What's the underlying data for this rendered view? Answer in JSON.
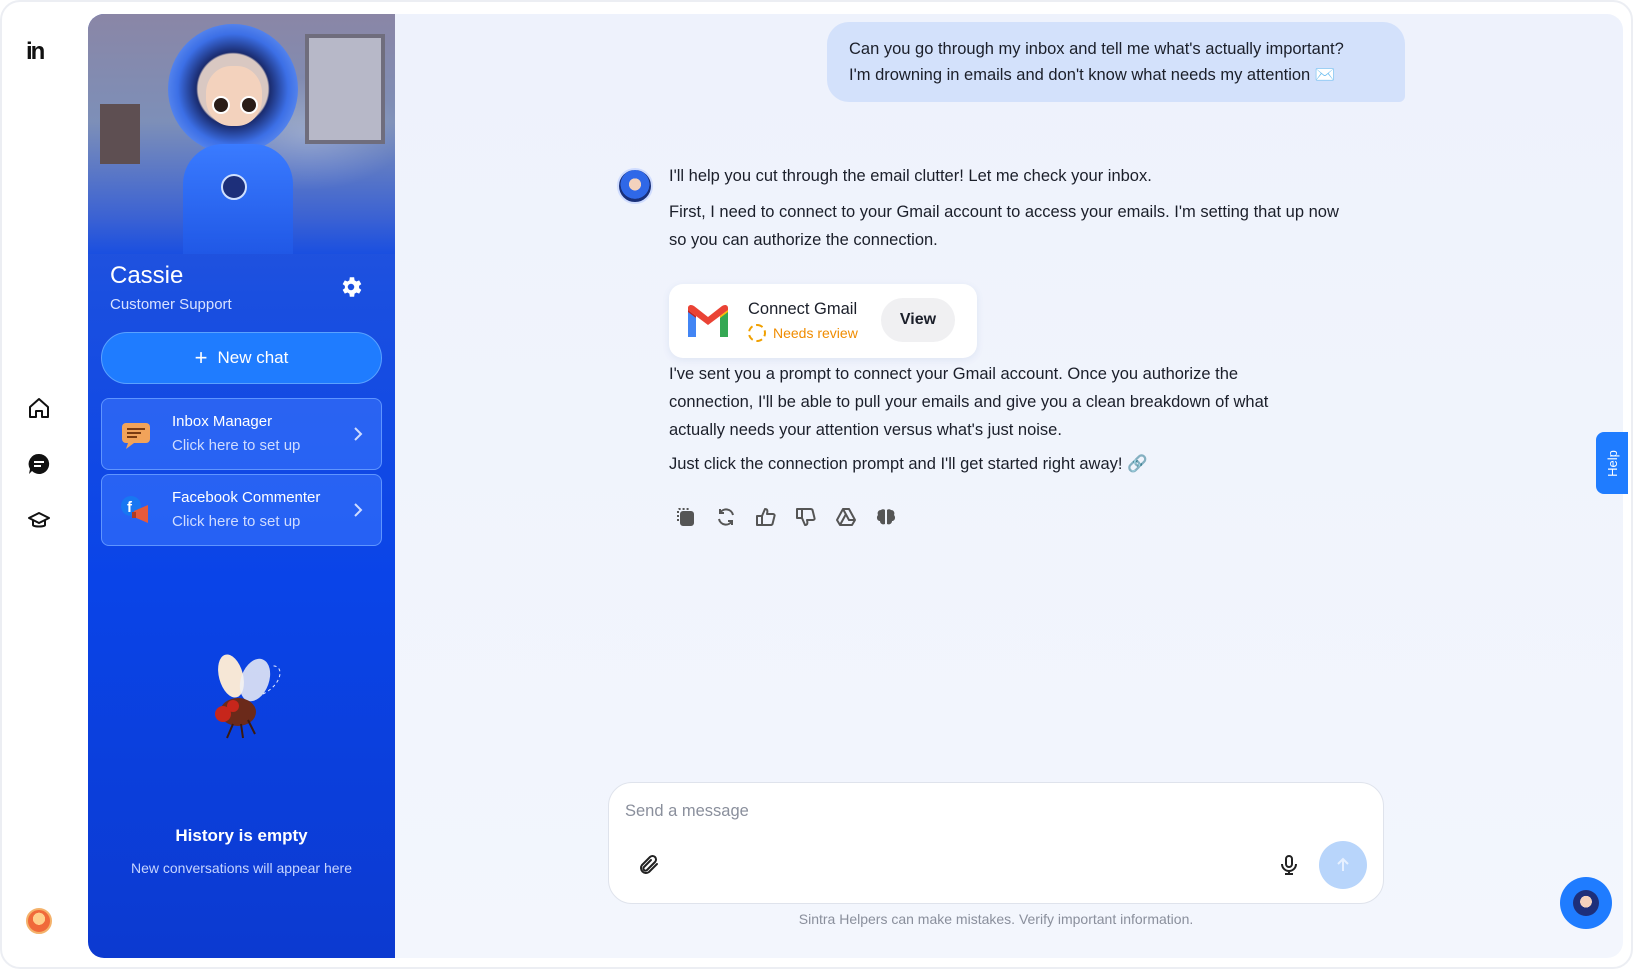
{
  "rail": {
    "logo_text": "in",
    "icons": [
      "home-icon",
      "chat-bubble-icon",
      "graduation-cap-icon"
    ]
  },
  "agent": {
    "name": "Cassie",
    "role": "Customer Support",
    "settings_icon": "gear-icon"
  },
  "sidebar": {
    "new_chat_label": "New chat",
    "helpers": [
      {
        "title": "Inbox Manager",
        "subtitle": "Click here to set up",
        "icon": "inbox-manager-icon"
      },
      {
        "title": "Facebook Commenter",
        "subtitle": "Click here to set up",
        "icon": "facebook-commenter-icon"
      }
    ],
    "history_title": "History is empty",
    "history_subtitle": "New conversations will appear here"
  },
  "chat": {
    "user_message_line1": "Can you go through my inbox and tell me what's actually important?",
    "user_message_line2": "I'm drowning in emails and don't know what needs my attention ✉️",
    "bot_messages": [
      "I'll help you cut through the email clutter! Let me check your inbox.",
      "First, I need to connect to your Gmail account to access your emails. I'm setting that up now so you can authorize the connection.",
      "I've sent you a prompt to connect your Gmail account. Once you authorize the connection, I'll be able to pull your emails and give you a clean breakdown of what actually needs your attention versus what's just noise.",
      "Just click the connection prompt and I'll get started right away! 🔗"
    ],
    "gmail_card": {
      "title": "Connect Gmail",
      "status": "Needs review",
      "button": "View"
    },
    "action_icons": [
      "copy-icon",
      "regenerate-icon",
      "thumbs-up-icon",
      "thumbs-down-icon",
      "drive-icon",
      "brain-icon"
    ]
  },
  "composer": {
    "placeholder": "Send a message",
    "disclaimer": "Sintra Helpers can make mistakes. Verify important information."
  },
  "help_tab_label": "Help",
  "colors": {
    "accent": "#1f7cff",
    "panel": "#0a44e8",
    "bubble": "#d3e1fb",
    "warning": "#f08c00"
  }
}
